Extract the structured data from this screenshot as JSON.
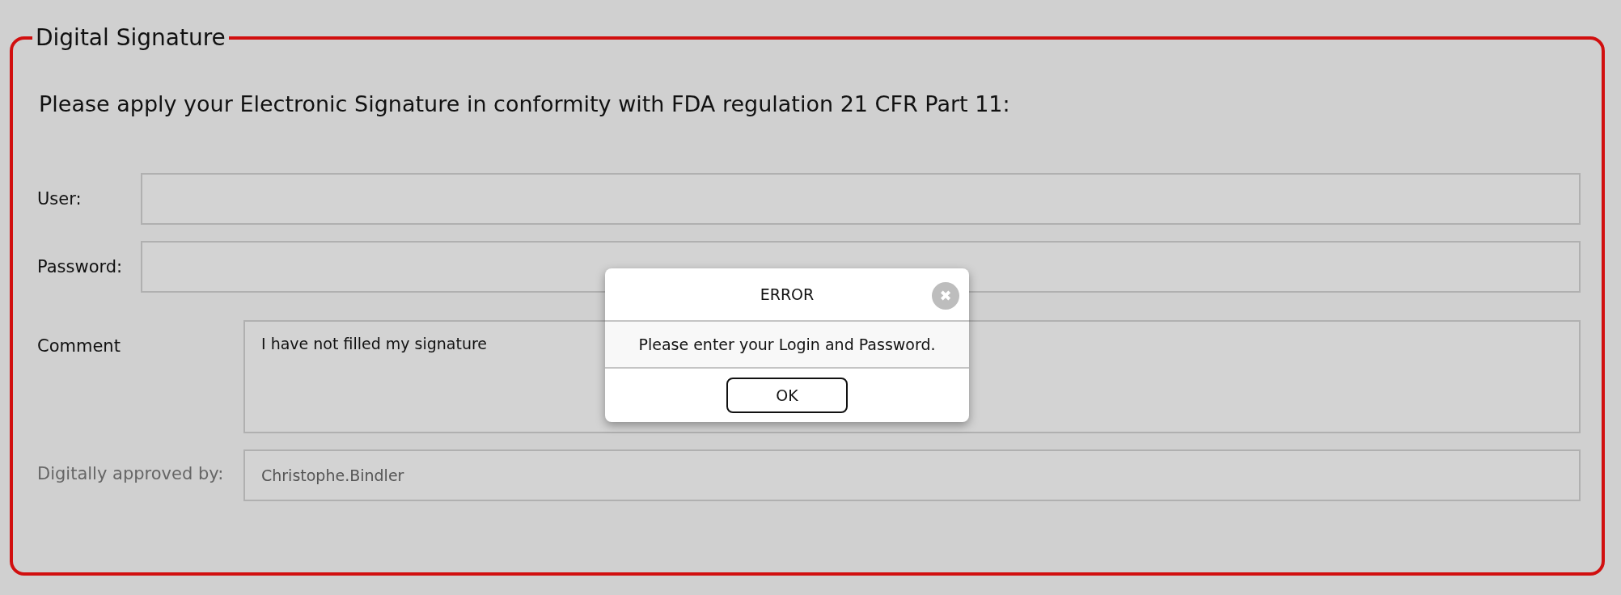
{
  "panel": {
    "legend": "Digital Signature",
    "heading": "Please apply your Electronic Signature in conformity with FDA regulation 21 CFR Part 11:"
  },
  "credentials": [
    {
      "label": "User:"
    },
    {
      "label": "Password:"
    }
  ],
  "details": [
    {
      "kind": "textarea",
      "label": "Comment",
      "value": "I have not filled my signature",
      "disabled": false
    },
    {
      "kind": "input",
      "label": "Digitally approved by:",
      "value": "Christophe.Bindler",
      "disabled": true
    }
  ],
  "dialog": {
    "title": "ERROR",
    "close": "✖",
    "message": "Please enter your Login and Password.",
    "button": "OK"
  }
}
